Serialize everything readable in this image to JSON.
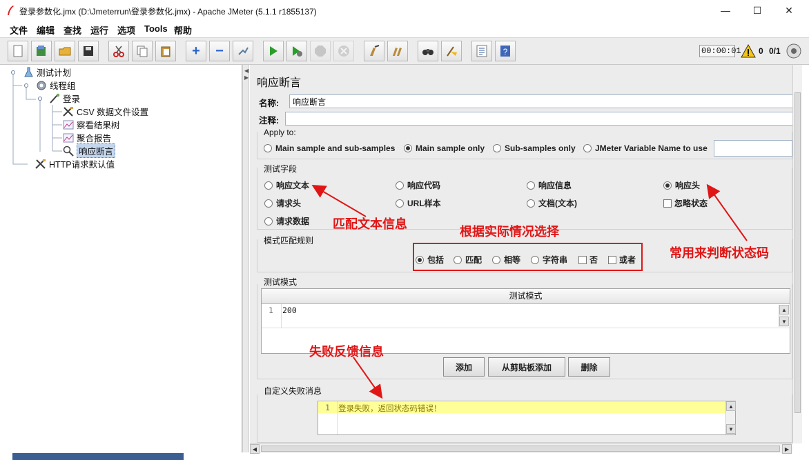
{
  "window": {
    "title": "登录参数化.jmx (D:\\Jmeterrun\\登录参数化.jmx) - Apache JMeter (5.1.1 r1855137)",
    "minimize": "—",
    "maximize": "☐",
    "close": "✕"
  },
  "menu": [
    "文件",
    "编辑",
    "查找",
    "运行",
    "选项",
    "Tools",
    "帮助"
  ],
  "toolbar": {
    "timer": "00:00:01",
    "warn_count": "0",
    "threads": "0/1",
    "icons": [
      "new-icon",
      "templates-icon",
      "open-icon",
      "save-icon",
      "cut-icon",
      "copy-icon",
      "paste-icon",
      "expand-icon",
      "collapse-icon",
      "toggle-icon",
      "start-icon",
      "start-no-pause-icon",
      "stop-icon",
      "shutdown-icon",
      "clear-icon",
      "clear-all-icon",
      "search-icon",
      "reset-search-icon",
      "function-helper-icon",
      "help-icon"
    ]
  },
  "tree": {
    "items": [
      {
        "label": "测试计划",
        "icon": "test-plan-icon"
      },
      {
        "label": "线程组",
        "icon": "thread-group-icon"
      },
      {
        "label": "登录",
        "icon": "sampler-icon"
      },
      {
        "label": "CSV 数据文件设置",
        "icon": "config-icon"
      },
      {
        "label": "察看结果树",
        "icon": "listener-icon"
      },
      {
        "label": "聚合报告",
        "icon": "listener-icon"
      },
      {
        "label": "响应断言",
        "icon": "assertion-icon"
      },
      {
        "label": "HTTP请求默认值",
        "icon": "config-icon"
      }
    ]
  },
  "panel": {
    "title": "响应断言",
    "name_label": "名称:",
    "name_value": "响应断言",
    "comment_label": "注释:",
    "comment_value": "",
    "apply_to": {
      "title": "Apply to:",
      "options": [
        "Main sample and sub-samples",
        "Main sample only",
        "Sub-samples only",
        "JMeter Variable Name to use"
      ],
      "selected": "Main sample only",
      "variable_value": ""
    },
    "field_to_test": {
      "title": "测试字段",
      "options": [
        "响应文本",
        "响应代码",
        "响应信息",
        "响应头",
        "请求头",
        "URL样本",
        "文档(文本)",
        "请求数据"
      ],
      "selected": "响应头",
      "ignore_status": "忽略状态"
    },
    "matching_rules": {
      "title": "模式匹配规则",
      "radios": [
        "包括",
        "匹配",
        "相等",
        "字符串"
      ],
      "selected": "包括",
      "checks": [
        "否",
        "或者"
      ]
    },
    "patterns": {
      "title": "测试模式",
      "column": "测试模式",
      "rows": [
        {
          "num": "1",
          "value": "200"
        }
      ],
      "buttons": [
        "添加",
        "从剪贴板添加",
        "删除"
      ]
    },
    "failure_message": {
      "title": "自定义失败消息",
      "line_num": "1",
      "value": "登录失败，返回状态码错误！"
    }
  },
  "annotations": {
    "match_text": "匹配文本信息",
    "choose": "根据实际情况选择",
    "status_code": "常用来判断状态码",
    "fail_msg": "失败反馈信息"
  },
  "colors": {
    "annotation": "#e01616",
    "selection": "#c4d6ee",
    "panel_bg": "#ececec",
    "message_highlight": "#ffff99"
  }
}
